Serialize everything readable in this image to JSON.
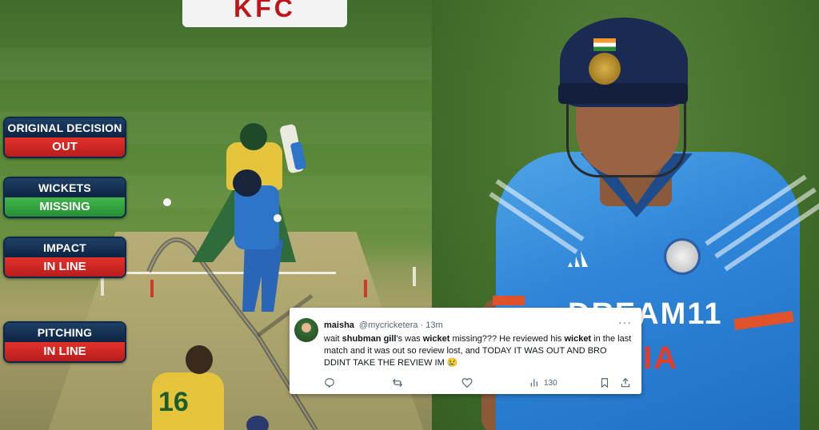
{
  "billboard": {
    "brand": "KFC"
  },
  "drs": {
    "original_decision": {
      "label": "ORIGINAL DECISION",
      "value": "OUT",
      "color": "#c8231f"
    },
    "wickets": {
      "label": "WICKETS",
      "value": "MISSING",
      "color": "#2f9e3a"
    },
    "impact": {
      "label": "IMPACT",
      "value": "IN LINE",
      "color": "#c8231f"
    },
    "pitching": {
      "label": "PITCHING",
      "value": "IN LINE",
      "color": "#c8231f"
    }
  },
  "keeper": {
    "shirt_number": "16"
  },
  "jersey": {
    "sponsor": "DREAM11",
    "country": "IA"
  },
  "tweet": {
    "display_name": "maisha",
    "handle": "@mycricketera",
    "separator": "·",
    "age": "13m",
    "text_parts": [
      {
        "t": "wait ",
        "bold": false
      },
      {
        "t": "shubman gill",
        "bold": true
      },
      {
        "t": "'s was ",
        "bold": false
      },
      {
        "t": "wicket",
        "bold": true
      },
      {
        "t": " missing??? He reviewed his ",
        "bold": false
      },
      {
        "t": "wicket",
        "bold": true
      },
      {
        "t": " in the last match and it was out so review lost, and TODAY IT WAS OUT AND BRO DDINT TAKE THE REVIEW IM 😢",
        "bold": false
      }
    ],
    "views": "130",
    "icons": [
      "reply-icon",
      "retweet-icon",
      "like-icon",
      "views-icon",
      "bookmark-icon",
      "share-icon"
    ]
  }
}
